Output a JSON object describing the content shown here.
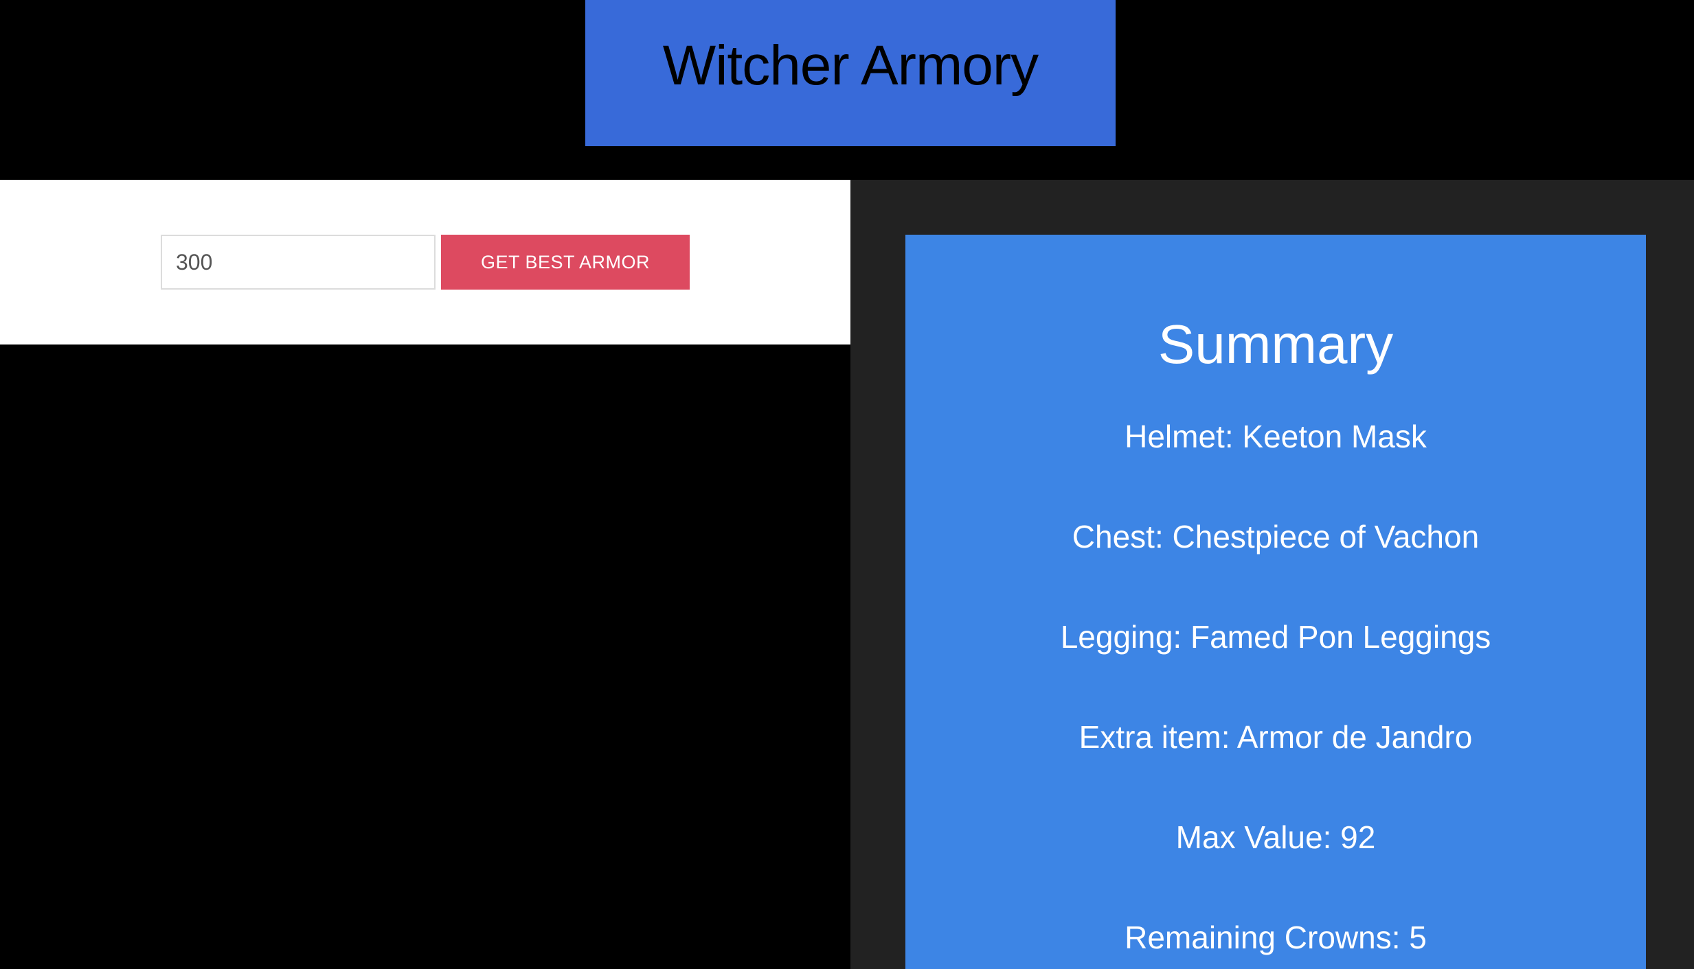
{
  "header": {
    "title": "Witcher Armory"
  },
  "form": {
    "budget_value": "300",
    "submit_label": "GET BEST ARMOR"
  },
  "summary": {
    "title": "Summary",
    "helmet": "Helmet: Keeton Mask",
    "chest": "Chest: Chestpiece of Vachon",
    "legging": "Legging: Famed Pon Leggings",
    "extra_item": "Extra item: Armor de Jandro",
    "max_value": "Max Value: 92",
    "remaining_crowns": "Remaining Crowns: 5"
  },
  "colors": {
    "title_bg": "#386ad9",
    "button_bg": "#dd4a60",
    "summary_bg": "#3d85e5",
    "right_panel_bg": "#222222",
    "page_bg": "#000000"
  }
}
